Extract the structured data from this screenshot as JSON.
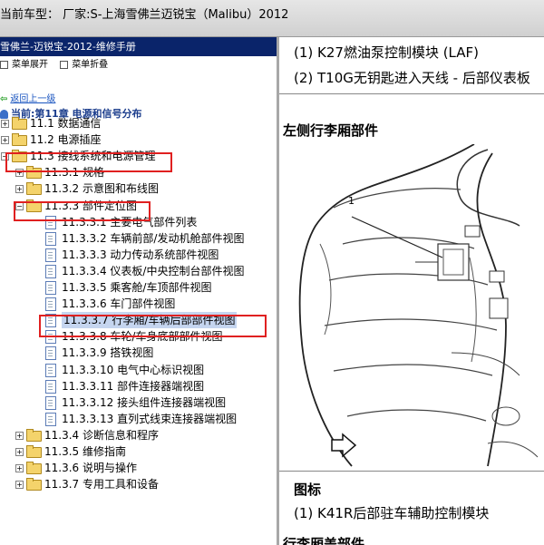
{
  "titlebar": {
    "text": "当前车型：  厂家:S-上海雪佛兰迈锐宝（Malibu）2012"
  },
  "left_panel": {
    "header": "雪佛兰-迈锐宝-2012-维修手册",
    "toolbar": {
      "expand_label": "菜单展开",
      "collapse_label": "菜单折叠"
    },
    "back_link": "返回上一级",
    "current": "当前:第11章 电源和信号分布",
    "tree": [
      {
        "label": "11.1 数据通信",
        "type": "folder",
        "level": 0,
        "expander": "+"
      },
      {
        "label": "11.2 电源插座",
        "type": "folder",
        "level": 0,
        "expander": "+"
      },
      {
        "label": "11.3 接线系统和电源管理",
        "type": "folder",
        "level": 0,
        "expander": "-"
      },
      {
        "label": "11.3.1 规格",
        "type": "folder",
        "level": 1,
        "expander": "+"
      },
      {
        "label": "11.3.2 示意图和布线图",
        "type": "folder",
        "level": 1,
        "expander": "+"
      },
      {
        "label": "11.3.3 部件定位图",
        "type": "folder",
        "level": 1,
        "expander": "-"
      },
      {
        "label": "11.3.3.1 主要电气部件列表",
        "type": "page",
        "level": 2
      },
      {
        "label": "11.3.3.2 车辆前部/发动机舱部件视图",
        "type": "page",
        "level": 2
      },
      {
        "label": "11.3.3.3 动力传动系统部件视图",
        "type": "page",
        "level": 2
      },
      {
        "label": "11.3.3.4 仪表板/中央控制台部件视图",
        "type": "page",
        "level": 2
      },
      {
        "label": "11.3.3.5 乘客舱/车顶部件视图",
        "type": "page",
        "level": 2
      },
      {
        "label": "11.3.3.6 车门部件视图",
        "type": "page",
        "level": 2
      },
      {
        "label": "11.3.3.7 行李厢/车辆后部部件视图",
        "type": "page",
        "level": 2,
        "selected": true
      },
      {
        "label": "11.3.3.8 车轮/车身底部部件视图",
        "type": "page",
        "level": 2
      },
      {
        "label": "11.3.3.9 搭铁视图",
        "type": "page",
        "level": 2
      },
      {
        "label": "11.3.3.10 电气中心标识视图",
        "type": "page",
        "level": 2
      },
      {
        "label": "11.3.3.11 部件连接器端视图",
        "type": "page",
        "level": 2
      },
      {
        "label": "11.3.3.12 接头组件连接器端视图",
        "type": "page",
        "level": 2
      },
      {
        "label": "11.3.3.13 直列式线束连接器端视图",
        "type": "page",
        "level": 2
      },
      {
        "label": "11.3.4 诊断信息和程序",
        "type": "folder",
        "level": 1,
        "expander": "+"
      },
      {
        "label": "11.3.5 维修指南",
        "type": "folder",
        "level": 1,
        "expander": "+"
      },
      {
        "label": "11.3.6 说明与操作",
        "type": "folder",
        "level": 1,
        "expander": "+"
      },
      {
        "label": "11.3.7 专用工具和设备",
        "type": "folder",
        "level": 1,
        "expander": "+"
      }
    ]
  },
  "right_panel": {
    "line1": "(1) K27燃油泵控制模块 (LAF)",
    "line2": "(2) T10G无钥匙进入天线 - 后部仪表板",
    "section_title": "左侧行李厢部件",
    "callout_number": "1",
    "legend_title": "图标",
    "legend_item": "(1) K41R后部驻车辅助控制模块",
    "next_section": "行李厢盖部件"
  }
}
